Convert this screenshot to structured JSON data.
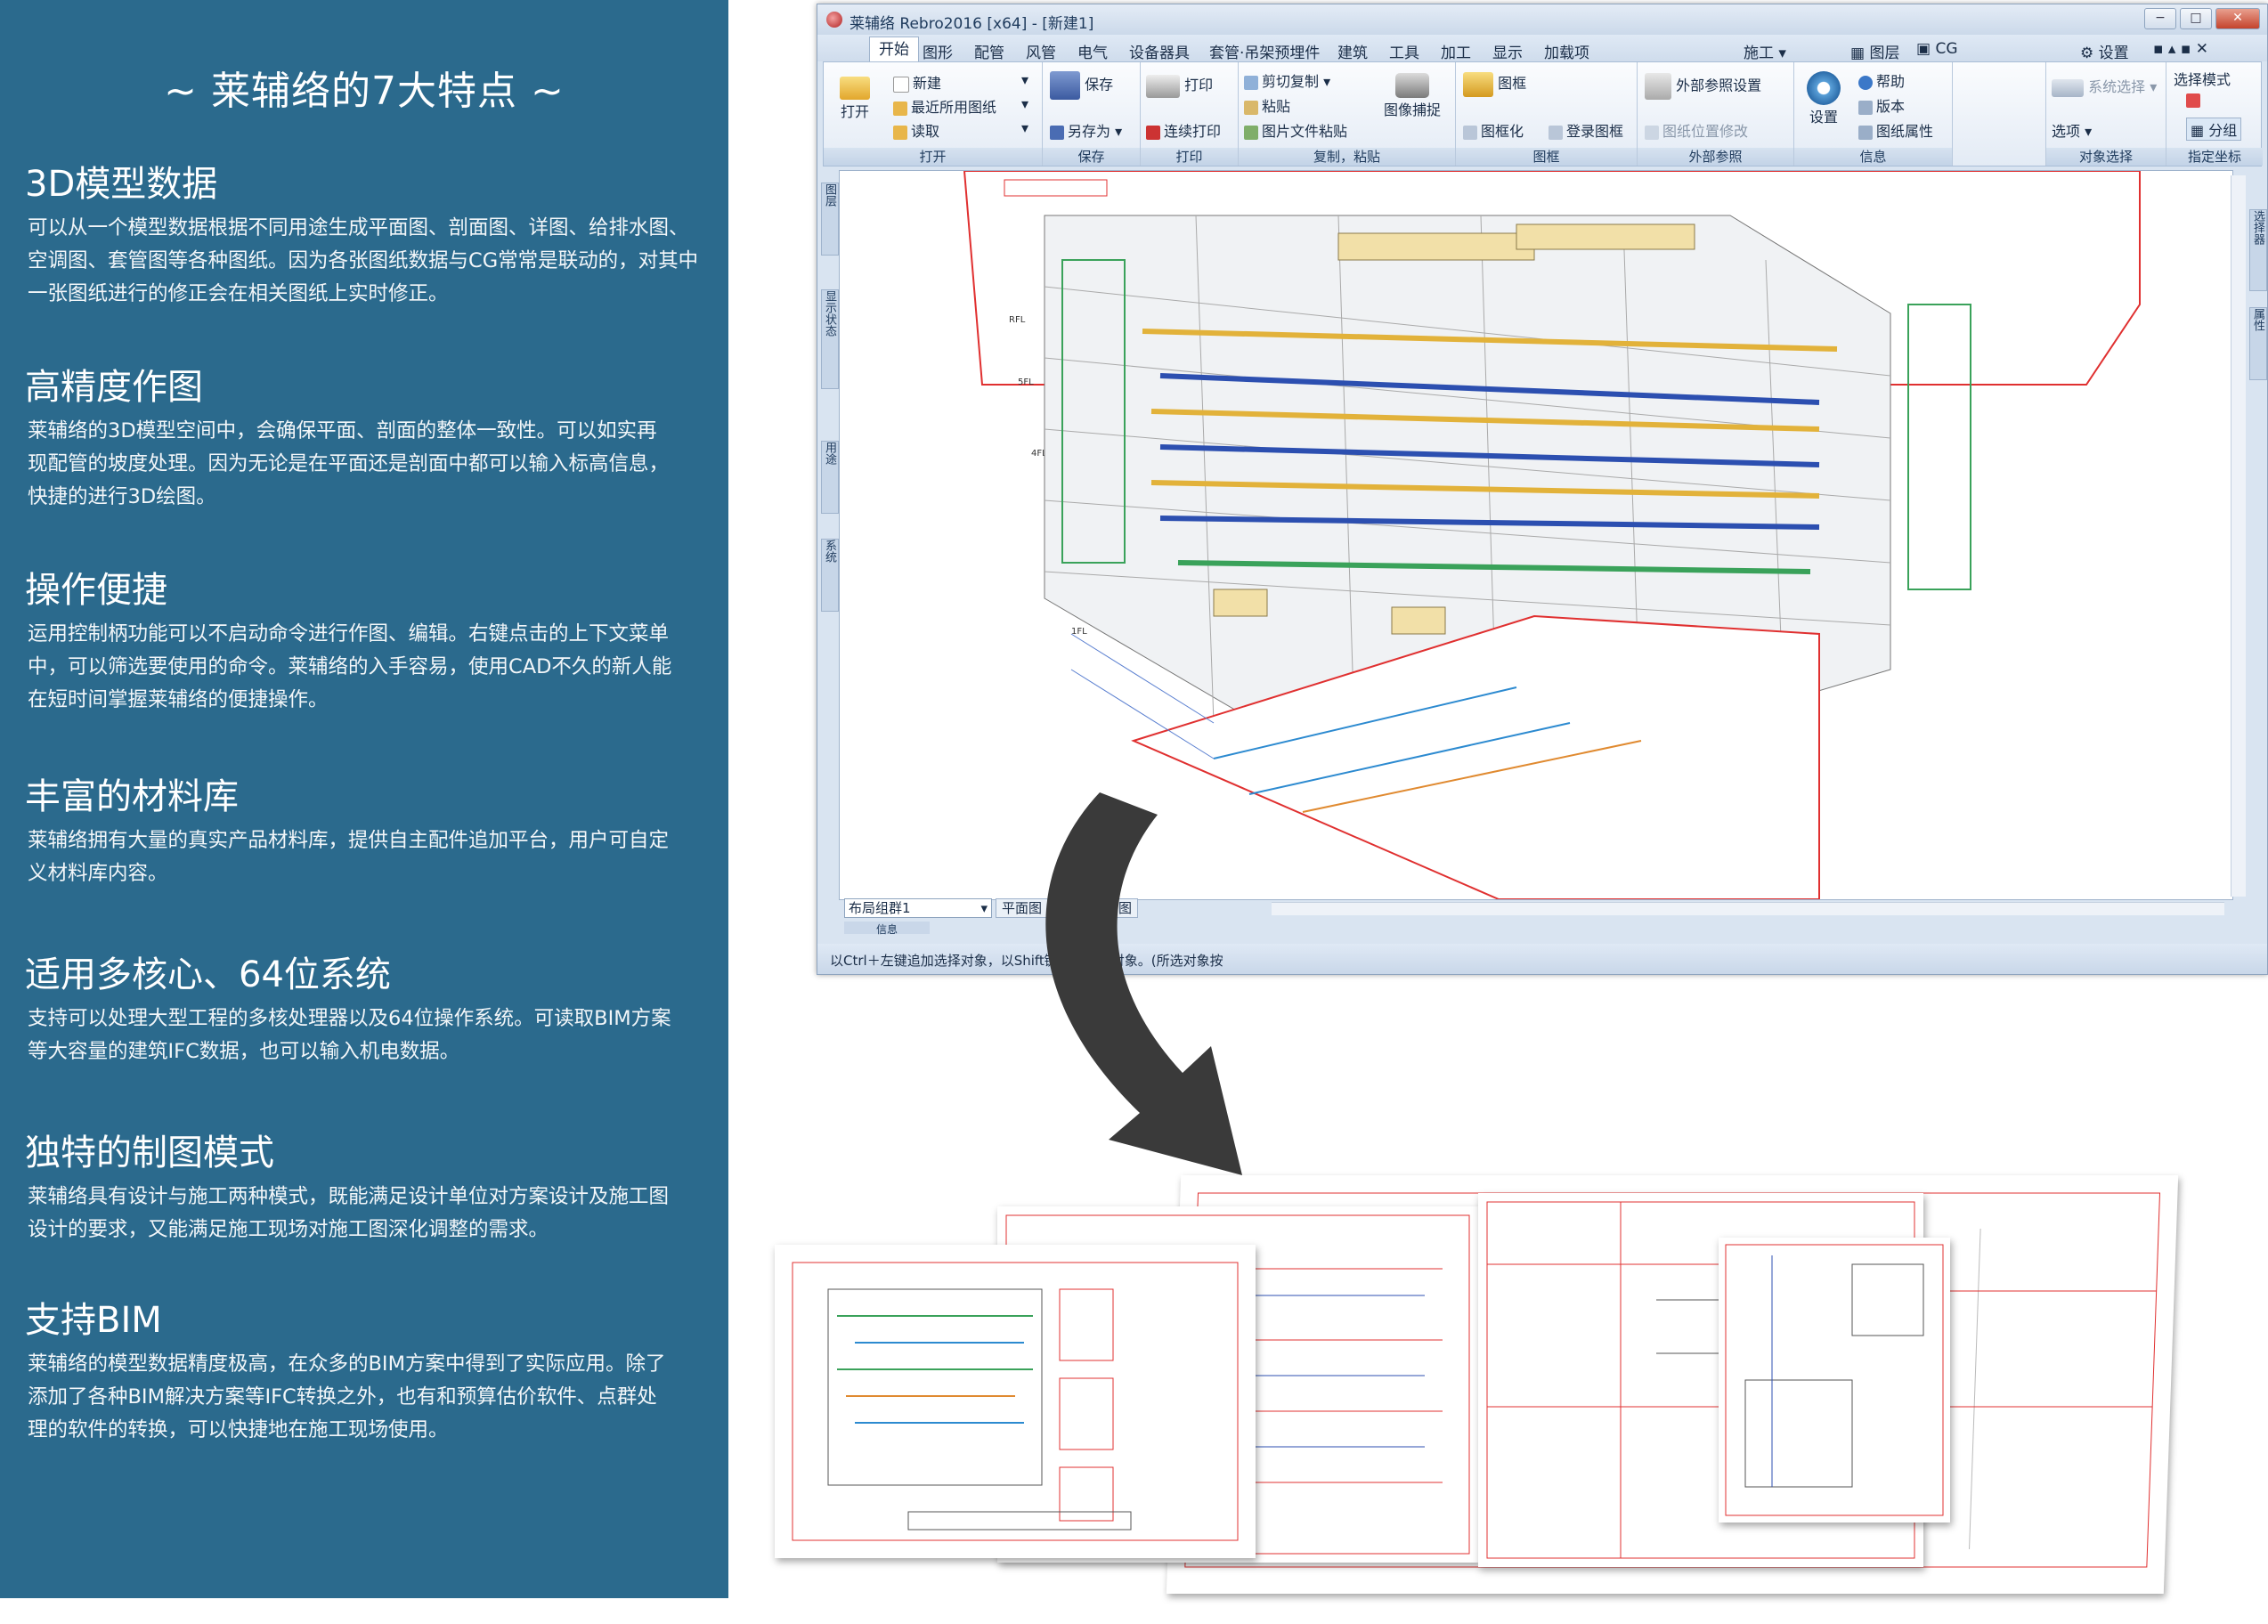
{
  "panel": {
    "title": "~ 莱辅络的7大特点 ~",
    "features": [
      {
        "heading": "3D模型数据",
        "lines": [
          "可以从一个模型数据根据不同用途生成平面图、剖面图、详图、给排水图、",
          "空调图、套管图等各种图纸。因为各张图纸数据与CG常常是联动的，对其中",
          "一张图纸进行的修正会在相关图纸上实时修正。"
        ]
      },
      {
        "heading": "高精度作图",
        "lines": [
          "莱辅络的3D模型空间中，会确保平面、剖面的整体一致性。可以如实再",
          "现配管的坡度处理。因为无论是在平面还是剖面中都可以输入标高信息，",
          "快捷的进行3D绘图。"
        ]
      },
      {
        "heading": "操作便捷",
        "lines": [
          "运用控制柄功能可以不启动命令进行作图、编辑。右键点击的上下文菜单",
          "中，可以筛选要使用的命令。莱辅络的入手容易，使用CAD不久的新人能",
          "在短时间掌握莱辅络的便捷操作。"
        ]
      },
      {
        "heading": "丰富的材料库",
        "lines": [
          "莱辅络拥有大量的真实产品材料库，提供自主配件追加平台，用户可自定",
          "义材料库内容。"
        ]
      },
      {
        "heading": "适用多核心、64位系统",
        "lines": [
          "支持可以处理大型工程的多核处理器以及64位操作系统。可读取BIM方案",
          "等大容量的建筑IFC数据，也可以输入机电数据。"
        ]
      },
      {
        "heading": "独特的制图模式",
        "lines": [
          "莱辅络具有设计与施工两种模式，既能满足设计单位对方案设计及施工图",
          "设计的要求，又能满足施工现场对施工图深化调整的需求。"
        ]
      },
      {
        "heading": "支持BIM",
        "lines": [
          "莱辅络的模型数据精度极高，在众多的BIM方案中得到了实际应用。除了",
          "添加了各种BIM解决方案等IFC转换之外，也有和预算估价软件、点群处",
          "理的软件的转换，可以快捷地在施工现场使用。"
        ]
      }
    ]
  },
  "window": {
    "title": "莱辅络 Rebro2016 [x64] - [新建1]",
    "menu": [
      "开始",
      "图形",
      "配管",
      "风管",
      "电气",
      "设备器具",
      "套管·吊架预埋件",
      "建筑",
      "工具",
      "加工",
      "显示",
      "加载项"
    ],
    "menu_right": {
      "mode": "施工",
      "layer": "图层",
      "cg": "CG",
      "settings": "设置"
    },
    "ribbon": {
      "open": {
        "big": "打开",
        "items": [
          "新建",
          "最近所用图纸",
          "读取"
        ],
        "label": "打开"
      },
      "save": {
        "big": "保存",
        "item": "另存为",
        "label": "保存"
      },
      "print": {
        "big": "打印",
        "item": "连续打印",
        "label": "打印"
      },
      "clipboard": {
        "items": [
          "剪切复制",
          "粘贴",
          "图片文件粘贴"
        ],
        "capture": "图像捕捉",
        "label": "复制，粘贴"
      },
      "frame": {
        "big": "图框",
        "items": [
          "图框化",
          "登录图框"
        ],
        "label": "图框"
      },
      "xref": {
        "big": "外部参照设置",
        "item": "图纸位置修改",
        "label": "外部参照"
      },
      "info": {
        "big": "设置",
        "items": [
          "帮助",
          "版本",
          "图纸属性"
        ],
        "label": "信息"
      },
      "select": {
        "big": "系统选择",
        "item": "选项",
        "label": "对象选择"
      },
      "coord": {
        "big": "选择模式",
        "item": "分组",
        "label": "指定坐标"
      }
    },
    "left_tabs": [
      "图层",
      "显示状态",
      "用途",
      "系统"
    ],
    "right_tabs": [
      "选择器",
      "属性"
    ],
    "layout_group": "布局组群1",
    "view_tabs": [
      "平面图",
      "平面全图"
    ],
    "info_tab": "信息",
    "status": "以Ctrl＋左键追加选择对象，以Shift键取消选择对象。(所选对象按"
  },
  "colors": {
    "panel_bg": "#2b6a8d",
    "arrow": "#3a3a3a",
    "accent_red": "#e03030"
  }
}
